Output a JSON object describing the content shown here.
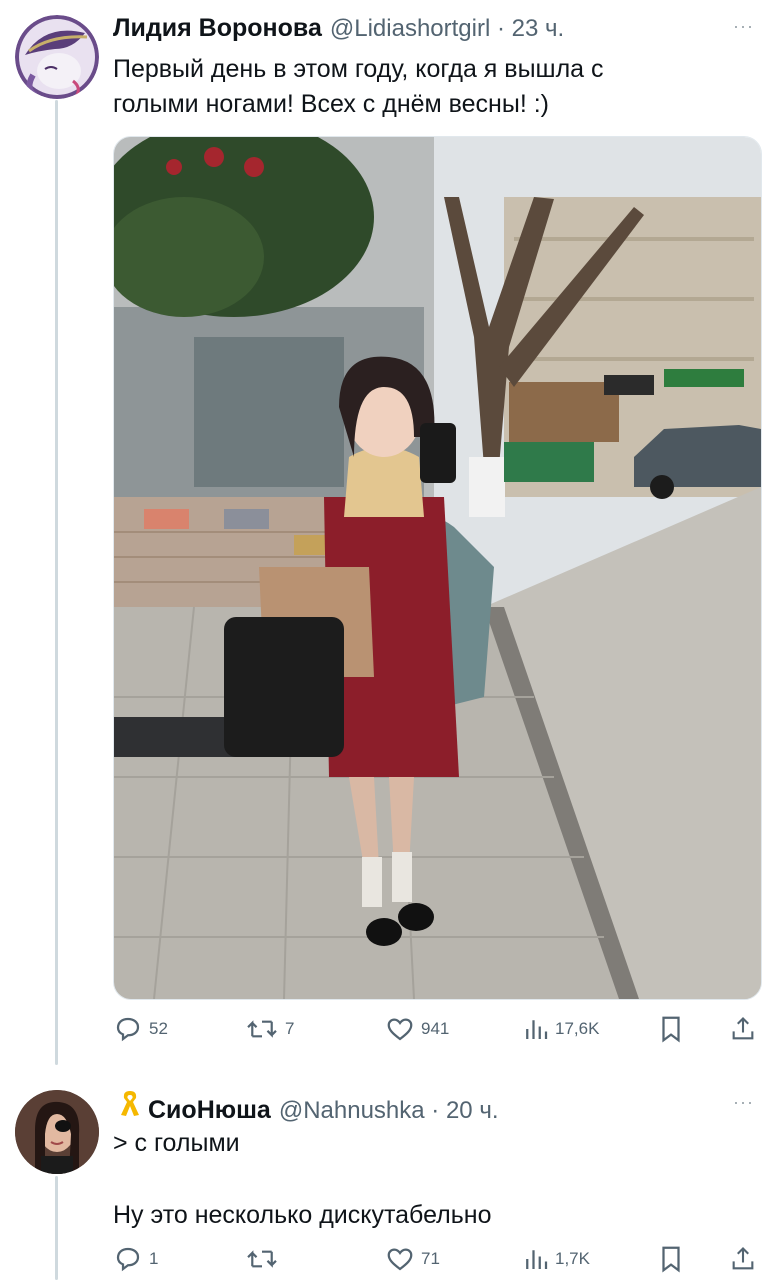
{
  "tweets": [
    {
      "author": "Лидия Воронова",
      "handle": "@Lidiashortgirl · 23 ч.",
      "text_line1": "Первый день в этом году, когда я вышла с",
      "text_line2": "голыми ногами! Всех с днём весны! :)",
      "actions": {
        "replies": "52",
        "retweets": "7",
        "likes": "941",
        "views": "17,6K"
      }
    },
    {
      "author_prefix_icon": "yellow-ribbon-icon",
      "author": "СиоНюша",
      "handle": "@Nahnushka · 20 ч.",
      "quote_line": "> с голыми",
      "text_line": "Ну это несколько дискутабельно",
      "actions": {
        "replies": "1",
        "retweets": "",
        "likes": "71",
        "views": "1,7K"
      }
    }
  ],
  "more_glyph": "···",
  "colors": {
    "text": "#0f1419",
    "secondary": "#536471",
    "thread_line": "#cfd9de",
    "ribbon": "#f5b800"
  }
}
